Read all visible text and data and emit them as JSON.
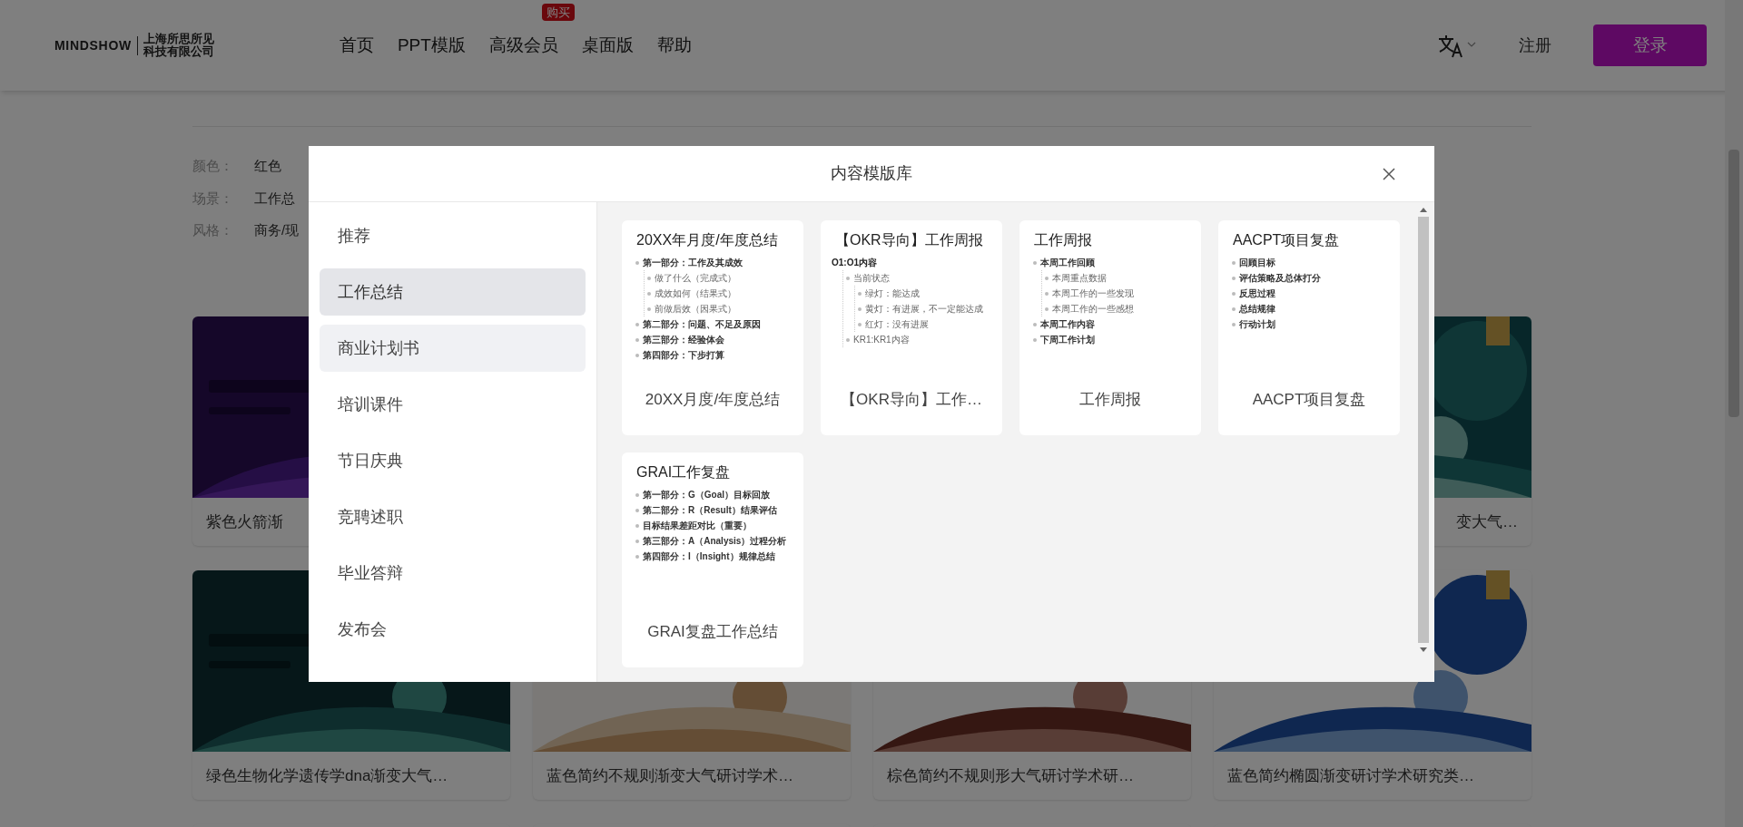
{
  "header": {
    "logo": {
      "brand": "MINDSHOW",
      "company": [
        "上海所思所见",
        "科技有限公司"
      ]
    },
    "nav": [
      {
        "label": "首页"
      },
      {
        "label": "PPT模版"
      },
      {
        "label": "高级会员",
        "badge": "购买"
      },
      {
        "label": "桌面版"
      },
      {
        "label": "帮助"
      }
    ],
    "register": "注册",
    "login": "登录"
  },
  "filters": [
    {
      "label": "颜色：",
      "value": "红色"
    },
    {
      "label": "场景：",
      "value": "工作总"
    },
    {
      "label": "风格：",
      "value": "商务/现"
    }
  ],
  "background_cards": {
    "row_1": [
      {
        "title": "紫色火箭渐"
      },
      {
        "title": "变大气…"
      }
    ],
    "row_2": [
      {
        "title": "绿色生物化学遗传学dna渐变大气…"
      },
      {
        "title": "蓝色简约不规则渐变大气研讨学术…"
      },
      {
        "title": "棕色简约不规则形大气研讨学术研…"
      },
      {
        "title": "蓝色简约椭圆渐变研讨学术研究类…"
      }
    ]
  },
  "modal": {
    "title": "内容模版库",
    "categories": [
      {
        "label": "推荐",
        "selected": false,
        "hovered": false
      },
      {
        "label": "工作总结",
        "selected": true,
        "hovered": false
      },
      {
        "label": "商业计划书",
        "selected": false,
        "hovered": true
      },
      {
        "label": "培训课件",
        "selected": false,
        "hovered": false
      },
      {
        "label": "节日庆典",
        "selected": false,
        "hovered": false
      },
      {
        "label": "竞聘述职",
        "selected": false,
        "hovered": false
      },
      {
        "label": "毕业答辩",
        "selected": false,
        "hovered": false
      },
      {
        "label": "发布会",
        "selected": false,
        "hovered": false
      }
    ],
    "templates": [
      {
        "preview": {
          "title": "20XX年月度/年度总结",
          "items": [
            {
              "text": "第一部分：工作及其成效",
              "children": [
                {
                  "text": "做了什么（完成式）"
                },
                {
                  "text": "成效如何（结果式）"
                },
                {
                  "text": "前做后效（因果式）"
                }
              ]
            },
            {
              "text": "第二部分：问题、不足及原因"
            },
            {
              "text": "第三部分：经验体会"
            },
            {
              "text": "第四部分：下步打算"
            }
          ]
        },
        "caption": "20XX月度/年度总结"
      },
      {
        "preview": {
          "title": "【OKR导向】工作周报",
          "items": [
            {
              "text": "O1:O1内容",
              "kind": "heading",
              "children": [
                {
                  "text": "当前状态",
                  "children": [
                    {
                      "text": "绿灯：能达成"
                    },
                    {
                      "text": "黄灯：有进展，不一定能达成"
                    },
                    {
                      "text": "红灯：没有进展"
                    }
                  ]
                },
                {
                  "text": "KR1:KR1内容"
                }
              ]
            }
          ]
        },
        "caption": "【OKR导向】工作…"
      },
      {
        "preview": {
          "title": "工作周报",
          "items": [
            {
              "text": "本周工作回顾",
              "children": [
                {
                  "text": "本周重点数据"
                },
                {
                  "text": "本周工作的一些发现"
                },
                {
                  "text": "本周工作的一些感想"
                }
              ]
            },
            {
              "text": "本周工作内容"
            },
            {
              "text": "下周工作计划"
            }
          ]
        },
        "caption": "工作周报"
      },
      {
        "preview": {
          "title": "AACPT项目复盘",
          "items": [
            {
              "text": "回顾目标"
            },
            {
              "text": "评估策略及总体打分"
            },
            {
              "text": "反思过程"
            },
            {
              "text": "总结规律"
            },
            {
              "text": "行动计划"
            }
          ]
        },
        "caption": "AACPT项目复盘"
      },
      {
        "preview": {
          "title": "GRAI工作复盘",
          "items": [
            {
              "text": "第一部分：G（Goal）目标回放"
            },
            {
              "text": "第二部分：R（Result）结果评估"
            },
            {
              "text": "目标结果差距对比（重要）"
            },
            {
              "text": "第三部分：A（Analysis）过程分析"
            },
            {
              "text": "第四部分：I（Insight）规律总结"
            }
          ]
        },
        "caption": "GRAI复盘工作总结"
      }
    ]
  }
}
